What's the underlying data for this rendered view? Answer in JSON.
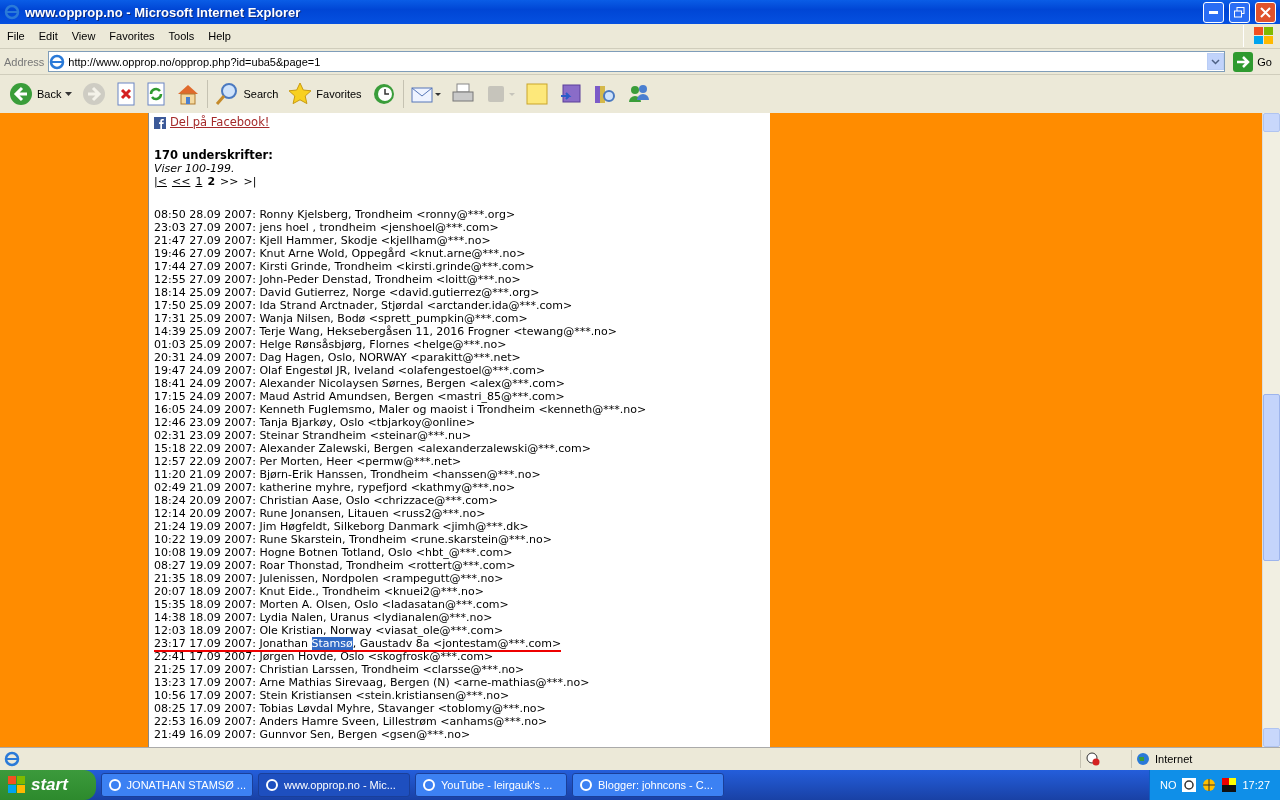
{
  "window": {
    "title": "www.opprop.no - Microsoft Internet Explorer"
  },
  "menu": [
    "File",
    "Edit",
    "View",
    "Favorites",
    "Tools",
    "Help"
  ],
  "address": {
    "label": "Address",
    "url": "http://www.opprop.no/opprop.php?id=uba5&page=1",
    "go": "Go"
  },
  "toolbar": [
    {
      "kind": "back",
      "label": "Back",
      "disabled": false
    },
    {
      "kind": "forward",
      "disabled": true
    },
    {
      "kind": "stop",
      "disabled": false
    },
    {
      "kind": "refresh",
      "disabled": false
    },
    {
      "kind": "home",
      "disabled": false
    },
    {
      "kind": "search",
      "label": "Search",
      "disabled": false
    },
    {
      "kind": "favorites",
      "label": "Favorites",
      "disabled": false
    },
    {
      "kind": "history",
      "disabled": false
    },
    {
      "kind": "mail",
      "disabled": false
    },
    {
      "kind": "print",
      "disabled": false
    },
    {
      "kind": "edit",
      "disabled": true
    },
    {
      "kind": "note",
      "disabled": false
    },
    {
      "kind": "messenger",
      "disabled": false
    },
    {
      "kind": "research",
      "disabled": false
    },
    {
      "kind": "contacts",
      "disabled": false
    }
  ],
  "page": {
    "share_link": "Del på Facebook!",
    "count_heading": "170 underskrifter:",
    "range": "Viser 100-199.",
    "pager": [
      {
        "label": "|<",
        "kind": "link"
      },
      {
        "label": "<<",
        "kind": "link"
      },
      {
        "label": "1",
        "kind": "link"
      },
      {
        "label": "2",
        "kind": "current"
      },
      {
        "label": ">>",
        "kind": "disabled"
      },
      {
        "label": ">|",
        "kind": "disabled"
      }
    ],
    "entries": [
      {
        "kind": "plain",
        "text": "08:50 28.09 2007: Ronny Kjelsberg, Trondheim <ronny@***.org>"
      },
      {
        "kind": "plain",
        "text": "23:03 27.09 2007: jens hoel , trondheim <jenshoel@***.com>"
      },
      {
        "kind": "plain",
        "text": "21:47 27.09 2007: Kjell Hammer, Skodje <kjellham@***.no>"
      },
      {
        "kind": "plain",
        "text": "19:46 27.09 2007: Knut Arne Wold, Oppegård <knut.arne@***.no>"
      },
      {
        "kind": "plain",
        "text": "17:44 27.09 2007: Kirsti Grinde, Trondheim <kirsti.grinde@***.com>"
      },
      {
        "kind": "plain",
        "text": "12:55 27.09 2007: John-Peder Denstad, Trondheim <loitt@***.no>"
      },
      {
        "kind": "plain",
        "text": "18:14 25.09 2007: David Gutierrez, Norge <david.gutierrez@***.org>"
      },
      {
        "kind": "plain",
        "text": "17:50 25.09 2007: Ida Strand Arctnader, Stjørdal <arctander.ida@***.com>"
      },
      {
        "kind": "plain",
        "text": "17:31 25.09 2007: Wanja Nilsen, Bodø <sprett_pumpkin@***.com>"
      },
      {
        "kind": "plain",
        "text": "14:39 25.09 2007: Terje Wang, Heksebergåsen 11, 2016 Frogner <tewang@***.no>"
      },
      {
        "kind": "plain",
        "text": "01:03 25.09 2007: Helge Rønsåsbjørg, Flornes <helge@***.no>"
      },
      {
        "kind": "plain",
        "text": "20:31 24.09 2007: Dag Hagen, Oslo, NORWAY <parakitt@***.net>"
      },
      {
        "kind": "plain",
        "text": "19:47 24.09 2007: Olaf Engestøl JR, Iveland <olafengestoel@***.com>"
      },
      {
        "kind": "plain",
        "text": "18:41 24.09 2007: Alexander Nicolaysen Sørnes, Bergen <alex@***.com>"
      },
      {
        "kind": "plain",
        "text": "17:15 24.09 2007: Maud Astrid Amundsen, Bergen <mastri_85@***.com>"
      },
      {
        "kind": "plain",
        "text": "16:05 24.09 2007: Kenneth Fuglemsmo, Maler og maoist i Trondheim <kenneth@***.no>"
      },
      {
        "kind": "plain",
        "text": "12:46 23.09 2007: Tanja Bjarkøy, Oslo <tbjarkoy@online>"
      },
      {
        "kind": "plain",
        "text": "02:31 23.09 2007: Steinar Strandheim <steinar@***.nu>"
      },
      {
        "kind": "plain",
        "text": "15:18 22.09 2007: Alexander Zalewski, Bergen <alexanderzalewski@***.com>"
      },
      {
        "kind": "plain",
        "text": "12:57 22.09 2007: Per Morten, Heer <permw@***.net>"
      },
      {
        "kind": "plain",
        "text": "11:20 21.09 2007: Bjørn-Erik Hanssen, Trondheim <hanssen@***.no>"
      },
      {
        "kind": "plain",
        "text": "02:49 21.09 2007: katherine myhre, rypefjord <kathmy@***.no>"
      },
      {
        "kind": "plain",
        "text": "18:24 20.09 2007: Christian Aase, Oslo <chrizzace@***.com>"
      },
      {
        "kind": "plain",
        "text": "12:14 20.09 2007: Rune Jonansen, Litauen <russ2@***.no>"
      },
      {
        "kind": "plain",
        "text": "21:24 19.09 2007: Jim Høgfeldt, Silkeborg Danmark <jimh@***.dk>"
      },
      {
        "kind": "plain",
        "text": "10:22 19.09 2007: Rune Skarstein, Trondheim <rune.skarstein@***.no>"
      },
      {
        "kind": "plain",
        "text": "10:08 19.09 2007: Hogne Botnen Totland, Oslo <hbt_@***.com>"
      },
      {
        "kind": "plain",
        "text": "08:27 19.09 2007: Roar Thonstad, Trondheim <rottert@***.com>"
      },
      {
        "kind": "plain",
        "text": "21:35 18.09 2007: Julenissen, Nordpolen <rampegutt@***.no>"
      },
      {
        "kind": "plain",
        "text": "20:07 18.09 2007: Knut Eide., Trondheim <knuei2@***.no>"
      },
      {
        "kind": "plain",
        "text": "15:35 18.09 2007: Morten A. Olsen, Oslo <ladasatan@***.com>"
      },
      {
        "kind": "plain",
        "text": "14:38 18.09 2007: Lydia Nalen, Uranus <lydianalen@***.no>"
      },
      {
        "kind": "plain",
        "text": "12:03 18.09 2007: Ole Kristian, Norway <viasat_ole@***.com>"
      },
      {
        "kind": "highlighted",
        "before": "23:17 17.09 2007: Jonathan ",
        "selected": "Stamsø",
        "after": ", Gaustadv 8a <jontestam@***.com>",
        "underlined": true
      },
      {
        "kind": "plain",
        "text": "22:41 17.09 2007: Jørgen Hovde, Oslo <skogfrosk@***.com>"
      },
      {
        "kind": "plain",
        "text": "21:25 17.09 2007: Christian Larssen, Trondheim <clarsse@***.no>"
      },
      {
        "kind": "plain",
        "text": "13:23 17.09 2007: Arne Mathias Sirevaag, Bergen (N) <arne-mathias@***.no>"
      },
      {
        "kind": "plain",
        "text": "10:56 17.09 2007: Stein Kristiansen <stein.kristiansen@***.no>"
      },
      {
        "kind": "plain",
        "text": "08:25 17.09 2007: Tobias Løvdal Myhre, Stavanger <toblomy@***.no>"
      },
      {
        "kind": "plain",
        "text": "22:53 16.09 2007: Anders Hamre Sveen, Lillestrøm <anhams@***.no>"
      },
      {
        "kind": "plain",
        "text": "21:49 16.09 2007: Gunnvor Sen, Bergen <gsen@***.no>"
      }
    ]
  },
  "status_bar": {
    "zone": "Internet"
  },
  "taskbar": {
    "start": "start",
    "tasks": [
      {
        "label": "JONATHAN STAMSØ ...",
        "selected": false
      },
      {
        "label": "www.opprop.no - Mic...",
        "selected": true
      },
      {
        "label": "YouTube - leirgauk's ...",
        "selected": false
      },
      {
        "label": "Blogger: johncons - C...",
        "selected": false
      }
    ],
    "language": "NO",
    "clock": "17:27"
  }
}
